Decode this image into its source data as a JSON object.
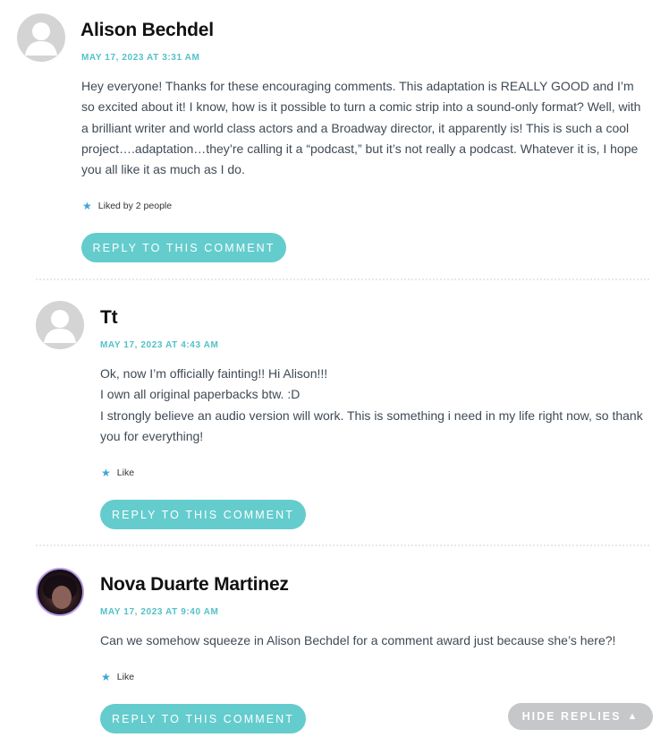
{
  "comments": [
    {
      "author": "Alison Bechdel",
      "date": "MAY 17, 2023 AT 3:31 AM",
      "body": [
        "Hey everyone! Thanks for these encouraging comments. This adaptation is REALLY GOOD and I’m so excited about it! I know, how is it possible to turn a comic strip into a sound-only format? Well, with a brilliant writer and world class actors and a Broadway director, it apparently is! This is such a cool project….adaptation…they’re calling it a “podcast,” but it’s not really a podcast. Whatever it is, I hope you all like it as much as I do."
      ],
      "like_text": "Liked by 2 people",
      "reply_label": "REPLY TO THIS COMMENT",
      "avatar_icon": "default-avatar-icon"
    },
    {
      "author": "Tt",
      "date": "MAY 17, 2023 AT 4:43 AM",
      "body": [
        "Ok, now I’m officially fainting!! Hi Alison!!!",
        "I own all original paperbacks btw. :D",
        "I strongly believe an audio version will work. This is something i need in my life right now, so thank you for everything!"
      ],
      "like_text": "Like",
      "reply_label": "REPLY TO THIS COMMENT",
      "avatar_icon": "default-avatar-icon"
    },
    {
      "author": "Nova Duarte Martinez",
      "date": "MAY 17, 2023 AT 9:40 AM",
      "body": [
        "Can we somehow squeeze in Alison Bechdel for a comment award just because she’s here?!"
      ],
      "like_text": "Like",
      "reply_label": "REPLY TO THIS COMMENT",
      "avatar_icon": "user-photo-avatar"
    }
  ],
  "hide_replies": {
    "label": "HIDE REPLIES",
    "icon": "triangle-up-icon"
  },
  "colors": {
    "accent": "#64cccd",
    "date": "#52c1c8",
    "star": "#3fa5d6",
    "hide_button": "#c5c7c8",
    "avatar_border": "#b89be6"
  }
}
